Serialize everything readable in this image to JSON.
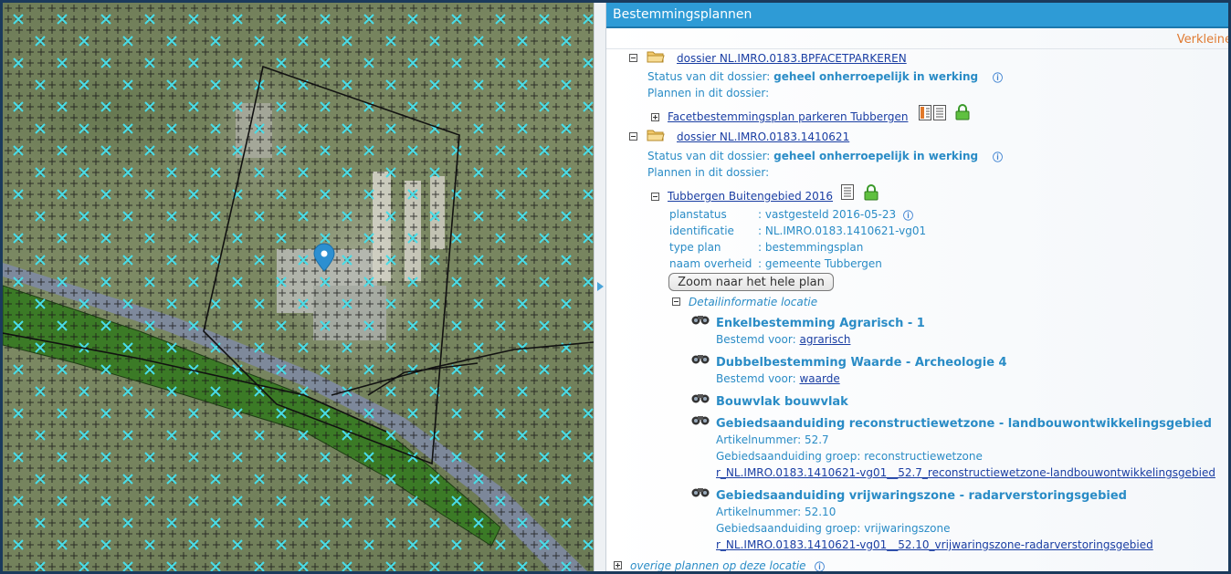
{
  "panel": {
    "title": "Bestemmingsplannen",
    "verkleinen": "Verkleine"
  },
  "dossiers": [
    {
      "name": "dossier NL.IMRO.0183.BPFACETPARKEREN",
      "status_label": "Status van dit dossier:",
      "status_value": "geheel onherroepelijk in werking",
      "plans_label": "Plannen in dit dossier:",
      "plan": "Facetbestemmingsplan parkeren Tubbergen"
    },
    {
      "name": "dossier NL.IMRO.0183.1410621",
      "status_label": "Status van dit dossier:",
      "status_value": "geheel onherroepelijk in werking",
      "plans_label": "Plannen in dit dossier:",
      "plan": "Tubbergen Buitengebied 2016"
    }
  ],
  "plan_details": {
    "rows": [
      {
        "key": "planstatus",
        "value": ": vastgesteld 2016-05-23"
      },
      {
        "key": "identificatie",
        "value": ": NL.IMRO.0183.1410621-vg01"
      },
      {
        "key": "type plan",
        "value": ": bestemmingsplan"
      },
      {
        "key": "naam overheid",
        "value": ": gemeente Tubbergen"
      }
    ],
    "zoom_button": "Zoom naar het hele plan",
    "detail_label": "Detailinformatie locatie"
  },
  "features": [
    {
      "title": "Enkelbestemming Agrarisch - 1",
      "sub_label": "Bestemd voor:",
      "sub_link": "agrarisch"
    },
    {
      "title": "Dubbelbestemming Waarde - Archeologie 4",
      "sub_label": "Bestemd voor:",
      "sub_link": "waarde"
    },
    {
      "title": "Bouwvlak bouwvlak"
    },
    {
      "title": "Gebiedsaanduiding reconstructiewetzone - landbouwontwikkelingsgebied",
      "artikel": "Artikelnummer: 52.7",
      "groep": "Gebiedsaanduiding groep: reconstructiewetzone",
      "link": "r_NL.IMRO.0183.1410621-vg01__52.7_reconstructiewetzone-landbouwontwikkelingsgebied"
    },
    {
      "title": "Gebiedsaanduiding vrijwaringszone - radarverstoringsgebied",
      "artikel": "Artikelnummer: 52.10",
      "groep": "Gebiedsaanduiding groep: vrijwaringszone",
      "link": "r_NL.IMRO.0183.1410621-vg01__52.10_vrijwaringszone-radarverstoringsgebied"
    }
  ],
  "footer": {
    "overige": "overige plannen op deze locatie"
  },
  "icons": {
    "info": "info-icon",
    "folder": "folder-icon",
    "document": "document-icon",
    "lock": "lock-icon",
    "binoculars": "binoculars-icon",
    "map_marker": "map-marker-icon"
  },
  "colors": {
    "header": "#2e9bd6",
    "accent_text": "#2a8cc6",
    "link": "#1a3ea3",
    "verkleinen": "#e07b32",
    "cross_marker": "#3fd6e0",
    "zone_green": "#3b7a26"
  }
}
